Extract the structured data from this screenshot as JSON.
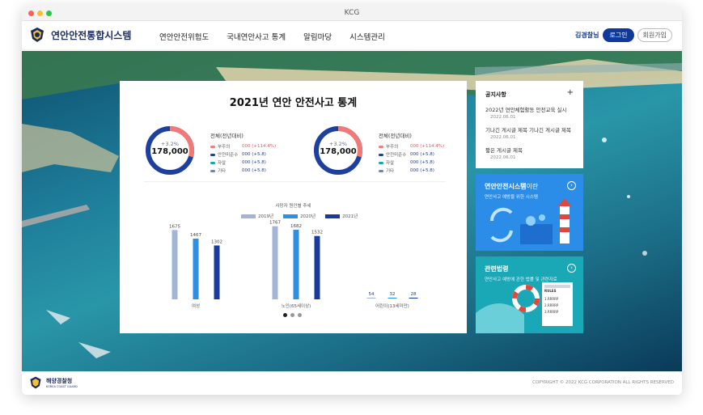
{
  "window": {
    "title": "KCG"
  },
  "header": {
    "brand": "연안안전통합시스템",
    "menu": [
      "연안안전위험도",
      "국내연안사고 통계",
      "알림마당",
      "시스템관리"
    ],
    "auth": {
      "link": "김경찰님",
      "login": "로그인",
      "join": "회원가입"
    }
  },
  "stats": {
    "title": "2021년 연안 안전사고 통계",
    "donuts": [
      {
        "change": "+3.2%",
        "total": "178,000",
        "legend_title": "전체(전년대비)",
        "items": [
          {
            "name": "부주의",
            "value": "000 (+114.4%)",
            "color": "#f07a7a",
            "red": true
          },
          {
            "name": "안전미준수",
            "value": "000 (+5.8)",
            "color": "#1d3f9e",
            "red": false
          },
          {
            "name": "자살",
            "value": "000 (+5.8)",
            "color": "#1aa5a8",
            "red": false
          },
          {
            "name": "기타",
            "value": "000 (+5.8)",
            "color": "#6f86b5",
            "red": false
          }
        ]
      },
      {
        "change": "+3.2%",
        "total": "178,000",
        "legend_title": "전체(전년대비)",
        "items": [
          {
            "name": "부주의",
            "value": "000 (+114.4%)",
            "color": "#f07a7a",
            "red": true
          },
          {
            "name": "안전미준수",
            "value": "000 (+5.8)",
            "color": "#1d3f9e",
            "red": false
          },
          {
            "name": "자살",
            "value": "000 (+5.8)",
            "color": "#1aa5a8",
            "red": false
          },
          {
            "name": "기타",
            "value": "000 (+5.8)",
            "color": "#6f86b5",
            "red": false
          }
        ]
      }
    ]
  },
  "chart_data": {
    "type": "bar",
    "title": "사망자 원인별 추세",
    "categories": [
      "여성",
      "노인(65세이상)",
      "어린이(13세미만)"
    ],
    "series": [
      {
        "name": "2019년",
        "values": [
          1675,
          1767,
          54
        ],
        "color": "#a3b4d8"
      },
      {
        "name": "2020년",
        "values": [
          1467,
          1682,
          32
        ],
        "color": "#2f8fe6"
      },
      {
        "name": "2021년",
        "values": [
          1302,
          1532,
          28
        ],
        "color": "#1b3aa0"
      }
    ],
    "ylim": [
      0,
      1800
    ]
  },
  "notice": {
    "title": "공지사항",
    "plus": "+",
    "items": [
      {
        "text": "2022년 연안체험활동 안전교육 실시",
        "date": "2022.06.01"
      },
      {
        "text": "기나긴 게시글 제목 기나긴 게시글 제목",
        "date": "2022.06.01"
      },
      {
        "text": "짧은 게시글 제목",
        "date": "2022.06.01"
      }
    ]
  },
  "cards": [
    {
      "title_bold": "연안안전시스템",
      "title_rest": "이란",
      "sub": "연안사고 예방을 위한 시스템"
    },
    {
      "title_bold": "관련법령",
      "title_rest": "",
      "sub": "연안사고 예방에 관한 법률 및 관련자료"
    }
  ],
  "card_illustration": {
    "rules_title": "RULES",
    "rules_items": [
      "1.RRRRP",
      "2.RRRRP",
      "3.RRRRP"
    ]
  },
  "footer": {
    "org": "해양경찰청",
    "org_en": "KOREA COAST GUARD",
    "copyright": "COPYRIGHT © 2022 KCG CORPORATION ALL RIGHTS RESERVED"
  },
  "colors": {
    "accent": "#0e3b9b",
    "card_blue": "#2c8de8",
    "card_teal": "#1aa8b6"
  },
  "pager": {
    "count": 3,
    "active": 0
  }
}
